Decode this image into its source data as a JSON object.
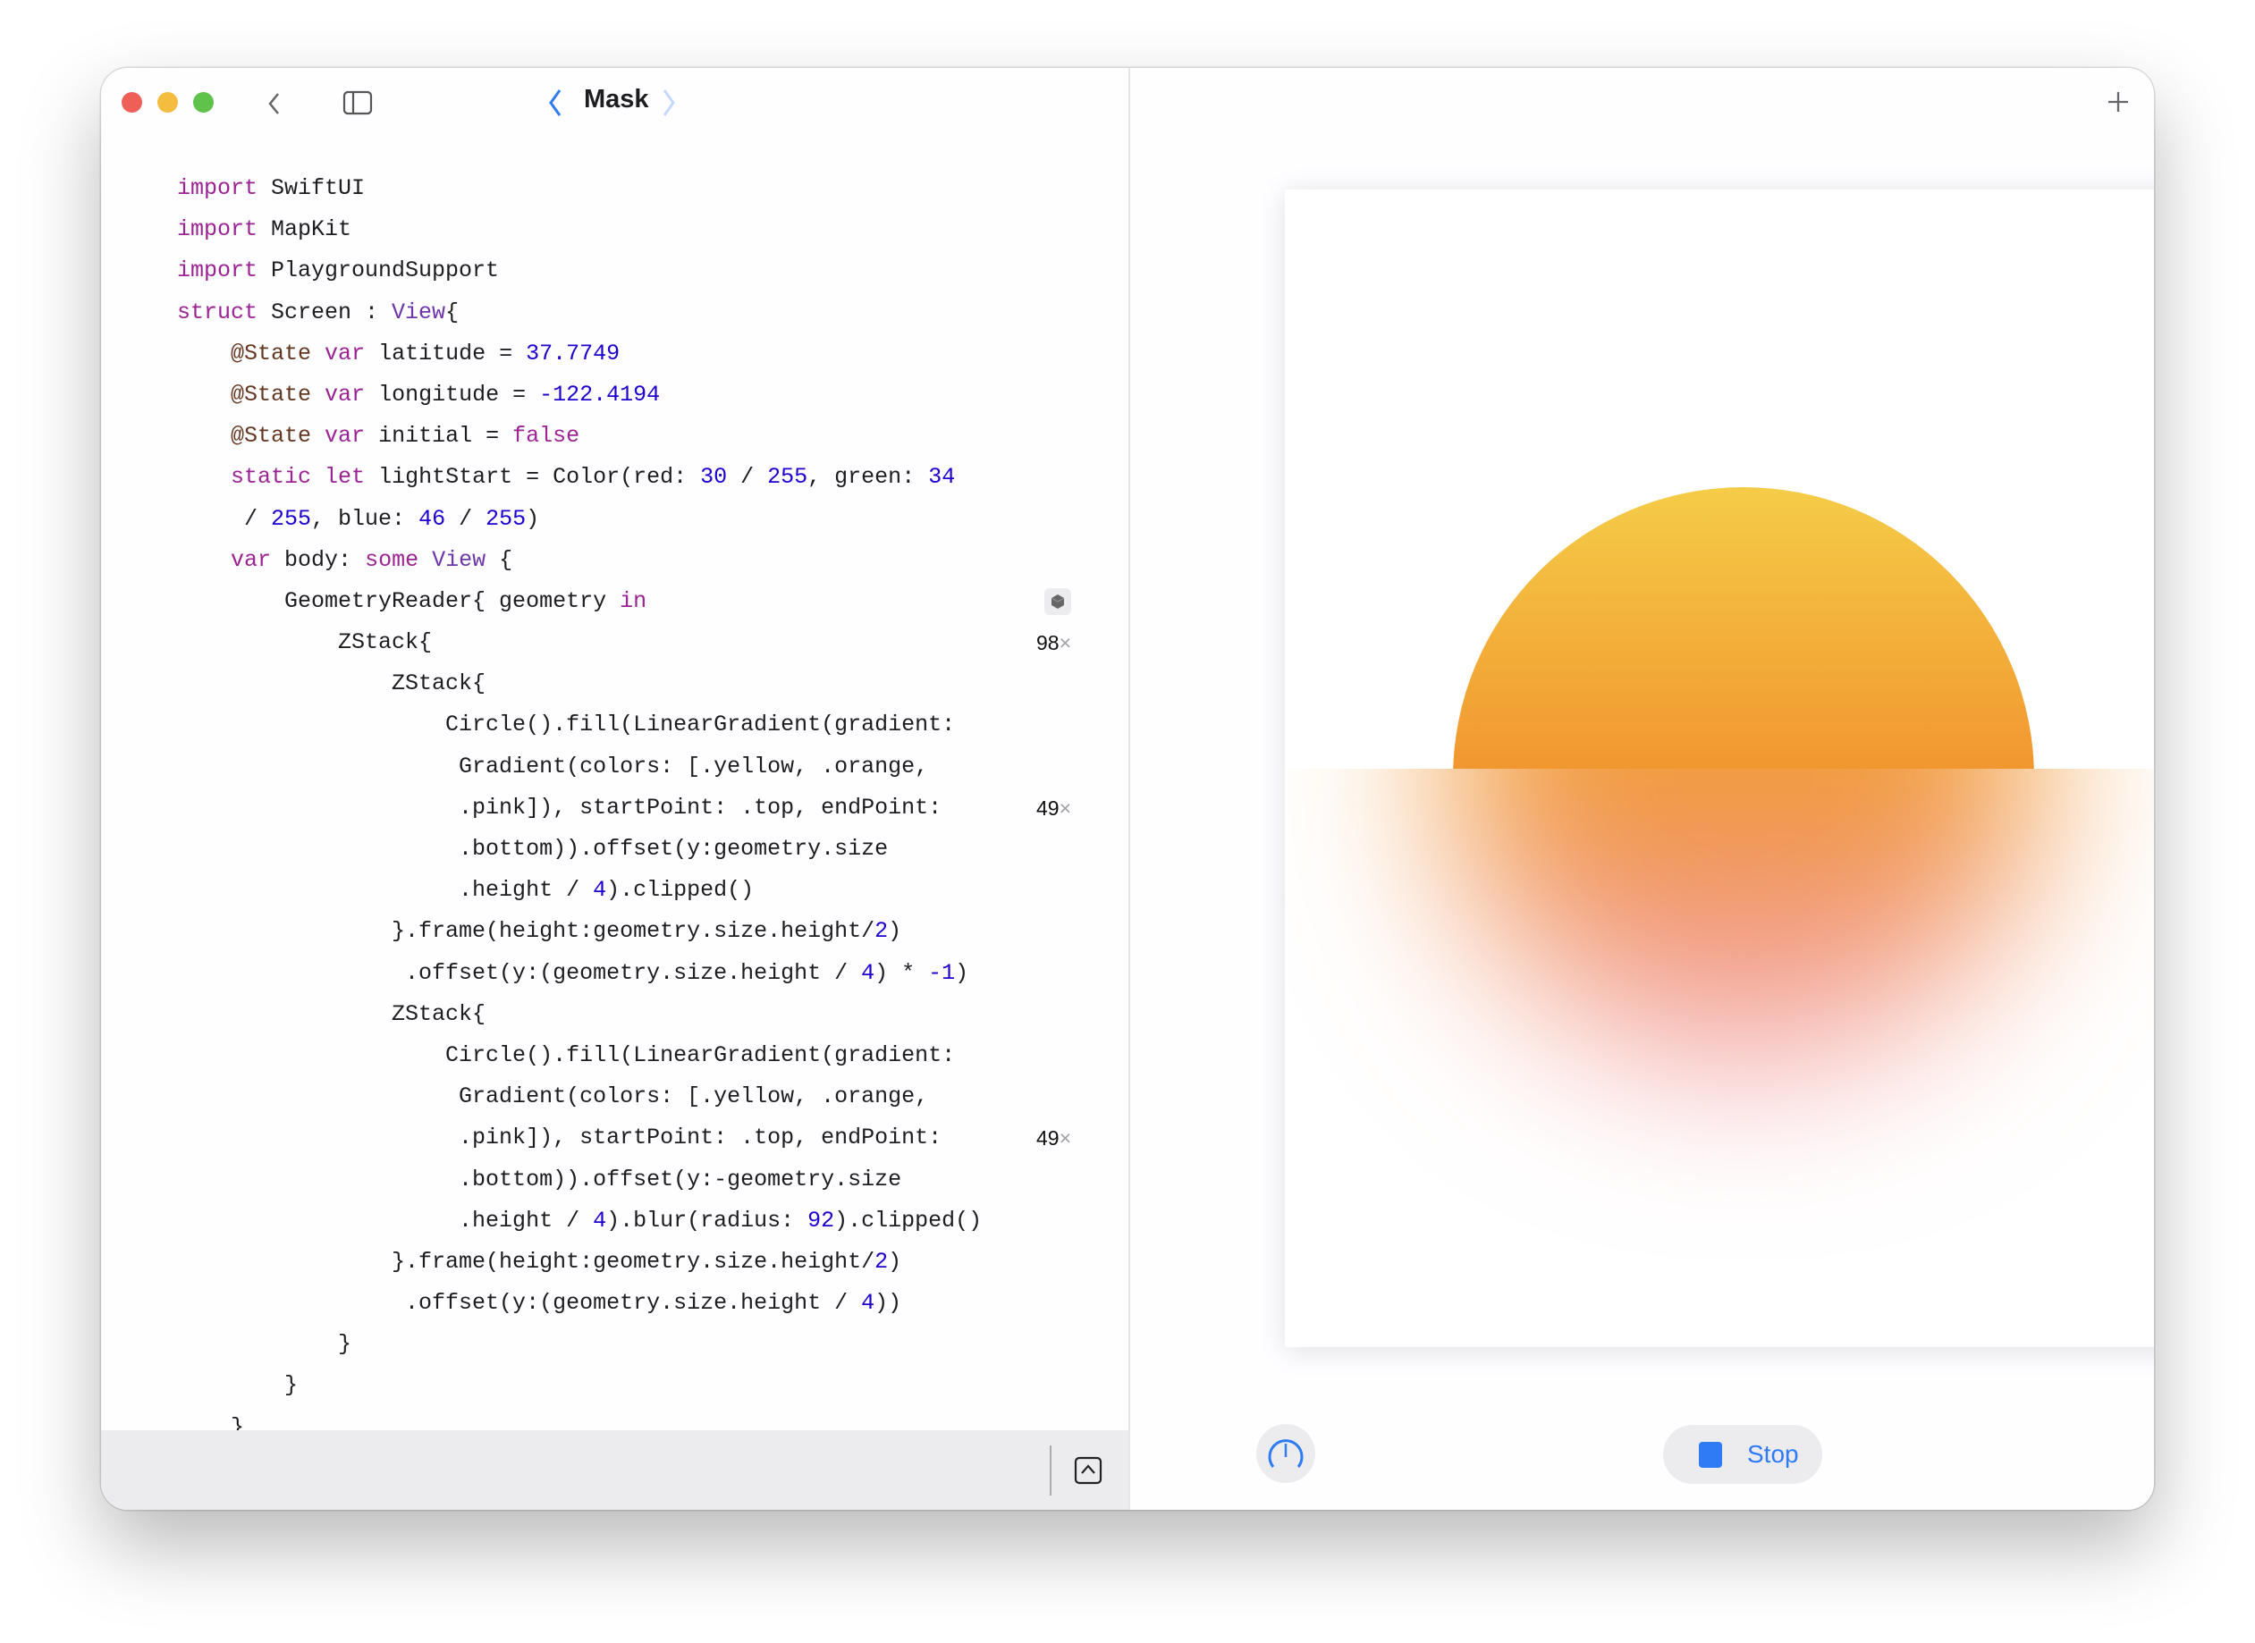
{
  "window": {
    "title": "Mask"
  },
  "colors": {
    "accent": "#2f7bf5",
    "keyword": "#9b2393",
    "number": "#1c00cf",
    "sun_top": "#f5cc48",
    "sun_bottom": "#f1952e"
  },
  "code": {
    "lines": [
      [
        [
          "import",
          "kw"
        ],
        [
          " SwiftUI",
          ""
        ]
      ],
      [
        [
          "import",
          "kw"
        ],
        [
          " MapKit",
          ""
        ]
      ],
      [
        [
          "import",
          "kw"
        ],
        [
          " PlaygroundSupport",
          ""
        ]
      ],
      [
        [
          "struct",
          "kw"
        ],
        [
          " Screen : ",
          ""
        ],
        [
          "View",
          "ty"
        ],
        [
          "{",
          ""
        ]
      ],
      [
        [
          "    @State",
          "attr"
        ],
        [
          " ",
          ""
        ],
        [
          "var",
          "kw"
        ],
        [
          " latitude = ",
          ""
        ],
        [
          "37.7749",
          "num"
        ]
      ],
      [
        [
          "    @State",
          "attr"
        ],
        [
          " ",
          ""
        ],
        [
          "var",
          "kw"
        ],
        [
          " longitude = ",
          ""
        ],
        [
          "-122.4194",
          "num"
        ]
      ],
      [
        [
          "    @State",
          "attr"
        ],
        [
          " ",
          ""
        ],
        [
          "var",
          "kw"
        ],
        [
          " initial = ",
          ""
        ],
        [
          "false",
          "kw"
        ]
      ],
      [
        [
          "    ",
          ""
        ],
        [
          "static",
          "kw"
        ],
        [
          " ",
          ""
        ],
        [
          "let",
          "kw"
        ],
        [
          " lightStart = Color(red: ",
          ""
        ],
        [
          "30",
          "num"
        ],
        [
          " / ",
          ""
        ],
        [
          "255",
          "num"
        ],
        [
          ", green: ",
          ""
        ],
        [
          "34",
          "num"
        ]
      ],
      [
        [
          "     / ",
          ""
        ],
        [
          "255",
          "num"
        ],
        [
          ", blue: ",
          ""
        ],
        [
          "46",
          "num"
        ],
        [
          " / ",
          ""
        ],
        [
          "255",
          "num"
        ],
        [
          ")",
          ""
        ]
      ],
      [
        [
          "    ",
          ""
        ],
        [
          "var",
          "kw"
        ],
        [
          " body: ",
          ""
        ],
        [
          "some",
          "kw"
        ],
        [
          " ",
          ""
        ],
        [
          "View",
          "ty"
        ],
        [
          " {",
          ""
        ]
      ],
      [
        [
          "        GeometryReader{ geometry ",
          ""
        ],
        [
          "in",
          "kw"
        ]
      ],
      [
        [
          "            ZStack{",
          ""
        ]
      ],
      [
        [
          "                ZStack{",
          ""
        ]
      ],
      [
        [
          "                    Circle().fill(LinearGradient(gradient:",
          ""
        ]
      ],
      [
        [
          "                     Gradient(colors: [.yellow, .orange,",
          ""
        ]
      ],
      [
        [
          "                     .pink]), startPoint: .top, endPoint:",
          ""
        ]
      ],
      [
        [
          "                     .bottom)).offset(y:geometry.size",
          ""
        ]
      ],
      [
        [
          "                     .height / ",
          ""
        ],
        [
          "4",
          "num"
        ],
        [
          ").clipped()",
          ""
        ]
      ],
      [
        [
          "                }.frame(height:geometry.size.height/",
          ""
        ],
        [
          "2",
          "num"
        ],
        [
          ")",
          ""
        ]
      ],
      [
        [
          "                 .offset(y:(geometry.size.height / ",
          ""
        ],
        [
          "4",
          "num"
        ],
        [
          ") * ",
          ""
        ],
        [
          "-1",
          "num"
        ],
        [
          ")",
          ""
        ]
      ],
      [
        [
          "                ZStack{",
          ""
        ]
      ],
      [
        [
          "                    Circle().fill(LinearGradient(gradient:",
          ""
        ]
      ],
      [
        [
          "                     Gradient(colors: [.yellow, .orange,",
          ""
        ]
      ],
      [
        [
          "                     .pink]), startPoint: .top, endPoint:",
          ""
        ]
      ],
      [
        [
          "                     .bottom)).offset(y:-geometry.size",
          ""
        ]
      ],
      [
        [
          "                     .height / ",
          ""
        ],
        [
          "4",
          "num"
        ],
        [
          ").blur(radius: ",
          ""
        ],
        [
          "92",
          "num"
        ],
        [
          ").clipped()",
          ""
        ]
      ],
      [
        [
          "                }.frame(height:geometry.size.height/",
          ""
        ],
        [
          "2",
          "num"
        ],
        [
          ")",
          ""
        ]
      ],
      [
        [
          "                 .offset(y:(geometry.size.height / ",
          ""
        ],
        [
          "4",
          "num"
        ],
        [
          "))",
          ""
        ]
      ],
      [
        [
          "            }",
          ""
        ]
      ],
      [
        [
          "        }",
          ""
        ]
      ],
      [
        [
          "    }",
          ""
        ]
      ]
    ],
    "badges": [
      {
        "line": 10,
        "icon": "cube-icon"
      },
      {
        "line": 11,
        "count": "98",
        "suffix": "×"
      },
      {
        "line": 15,
        "count": "49",
        "suffix": "×"
      },
      {
        "line": 23,
        "count": "49",
        "suffix": "×"
      }
    ]
  },
  "toolbar": {
    "stop_label": "Stop"
  }
}
